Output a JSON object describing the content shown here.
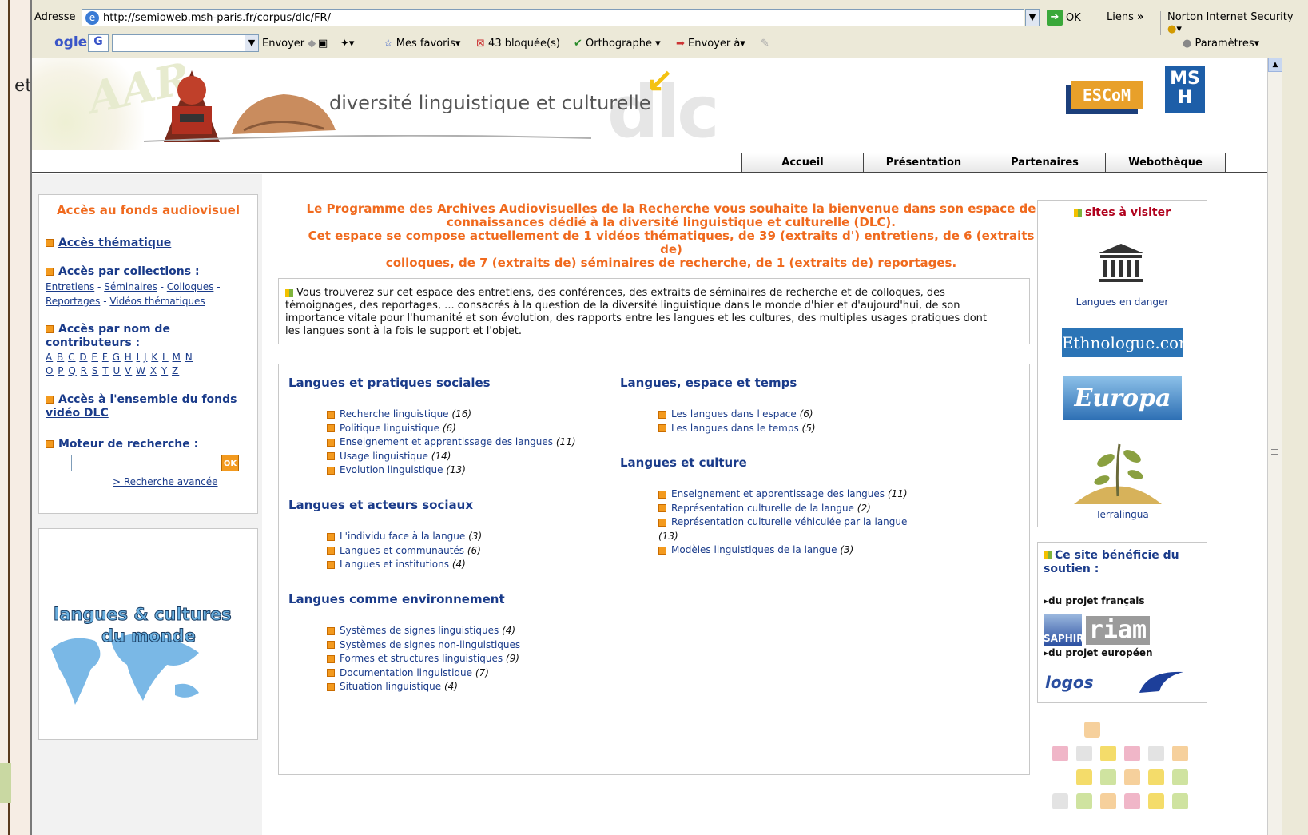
{
  "slide": {
    "fragment": "et"
  },
  "browser": {
    "address_label": "Adresse",
    "url": "http://semioweb.msh-paris.fr/corpus/dlc/FR/",
    "ok_label": "OK",
    "links_label": "Liens",
    "links_chevron": "»",
    "norton_label": "Norton Internet Security",
    "google_logo": "ogle",
    "google_g": "G",
    "send_label": "Envoyer",
    "favorites_label": "Mes favoris",
    "blocked_label": "43 bloquée(s)",
    "spelling_label": "Orthographe",
    "send_to_label": "Envoyer à",
    "settings_label": "Paramètres"
  },
  "header": {
    "title": "diversité linguistique et culturelle",
    "dlc_logo": "dlc",
    "escom_logo": "ESCoM",
    "msh_logo": "MS H"
  },
  "menu": [
    {
      "label": "Accueil"
    },
    {
      "label": "Présentation"
    },
    {
      "label": "Partenaires"
    },
    {
      "label": "Webothèque"
    }
  ],
  "left": {
    "fonds_title": "Accès au fonds audiovisuel",
    "thematic": "Accès thématique",
    "by_collection": "Accès par collections :",
    "collections": [
      "Entretiens",
      "Séminaires",
      "Colloques",
      "Reportages",
      "Vidéos thématiques"
    ],
    "by_contributor_1": "Accès par nom de",
    "by_contributor_2": "contributeurs :",
    "letters_row1": [
      "A",
      "B",
      "C",
      "D",
      "E",
      "F",
      "G",
      "H",
      "I",
      "J",
      "K",
      "L",
      "M",
      "N"
    ],
    "letters_row2": [
      "O",
      "P",
      "Q",
      "R",
      "S",
      "T",
      "U",
      "V",
      "W",
      "X",
      "Y",
      "Z"
    ],
    "whole_fonds_1": "Accès à l'ensemble du fonds",
    "whole_fonds_2": "vidéo DLC",
    "search_title": "Moteur de recherche :",
    "search_ok": "OK",
    "advanced_search": "> Recherche avancée",
    "monde_line1": "langues & cultures",
    "monde_line2": "du monde"
  },
  "welcome": {
    "line1": "Le Programme des Archives Audiovisuelles de la Recherche vous souhaite la bienvenue dans son espace de",
    "line2": "connaissances dédié à la diversité linguistique et culturelle (DLC).",
    "line3": "Cet espace se compose actuellement de 1 vidéos thématiques, de 39 (extraits d') entretiens, de 6 (extraits de)",
    "line4": "colloques, de 7 (extraits de) séminaires de recherche, de 1 (extraits de) reportages."
  },
  "intro": {
    "line1": "Vous trouverez sur cet espace des entretiens, des conférences, des extraits de séminaires de recherche et de colloques, des",
    "line2": "témoignages, des reportages, ... consacrés à la question de la diversité linguistique dans le monde d'hier et d'aujourd'hui, de son",
    "line3": "importance vitale pour l'humanité et son évolution, des rapports entre les langues et les cultures, des multiples usages pratiques dont",
    "line4": "les langues sont à la fois le support et l'objet."
  },
  "themes": {
    "pratiques": {
      "title": "Langues et pratiques sociales",
      "items": [
        {
          "label": "Recherche linguistique",
          "count": "(16)"
        },
        {
          "label": "Politique linguistique",
          "count": "(6)"
        },
        {
          "label": "Enseignement et apprentissage des langues",
          "count": "(11)"
        },
        {
          "label": "Usage linguistique",
          "count": "(14)"
        },
        {
          "label": "Evolution linguistique",
          "count": "(13)"
        }
      ]
    },
    "acteurs": {
      "title": "Langues et acteurs sociaux",
      "items": [
        {
          "label": "L'individu face à la langue",
          "count": "(3)"
        },
        {
          "label": "Langues et communautés",
          "count": "(6)"
        },
        {
          "label": "Langues et institutions",
          "count": "(4)"
        }
      ]
    },
    "environnement": {
      "title": "Langues comme environnement",
      "items": [
        {
          "label": "Systèmes de signes linguistiques",
          "count": "(4)"
        },
        {
          "label": "Systèmes de signes non-linguistiques",
          "count": ""
        },
        {
          "label": "Formes et structures linguistiques",
          "count": "(9)"
        },
        {
          "label": "Documentation linguistique",
          "count": "(7)"
        },
        {
          "label": "Situation linguistique",
          "count": "(4)"
        }
      ]
    },
    "espace": {
      "title": "Langues, espace et temps",
      "items": [
        {
          "label": "Les langues dans l'espace",
          "count": "(6)"
        },
        {
          "label": "Les langues dans le temps",
          "count": "(5)"
        }
      ]
    },
    "culture": {
      "title": "Langues et culture",
      "items": [
        {
          "label": "Enseignement et apprentissage des langues",
          "count": "(11)"
        },
        {
          "label": "Représentation culturelle de la langue",
          "count": "(2)"
        },
        {
          "label": "Représentation culturelle véhiculée par la langue",
          "count": "(13)"
        },
        {
          "label": "Modèles linguistiques de la langue",
          "count": "(3)"
        }
      ]
    }
  },
  "right": {
    "sites_title": "sites à visiter",
    "unesco_label": "Langues en danger",
    "ethnologue": "Ethnologue.com",
    "europa": "Europa",
    "terralingua_label": "Terralingua",
    "soutien_1": "Ce site bénéficie du",
    "soutien_2": "soutien :",
    "projet_fr": "du projet français",
    "saphir": "SAPHIR",
    "riam": "riam",
    "projet_eu": "du projet européen",
    "logos": "logos"
  }
}
